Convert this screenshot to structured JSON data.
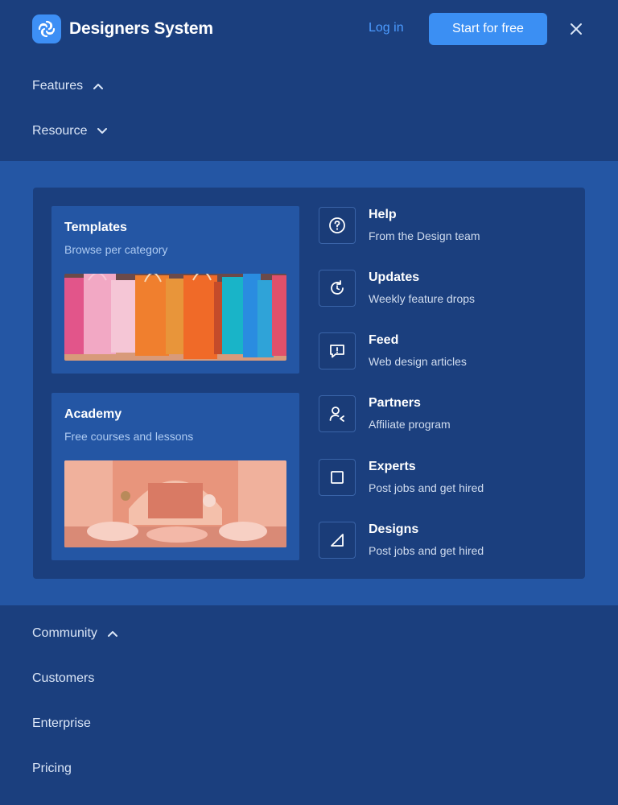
{
  "header": {
    "brand": "Designers System",
    "login_label": "Log in",
    "start_label": "Start for free"
  },
  "nav_top": [
    {
      "label": "Features",
      "expanded": true
    },
    {
      "label": "Resource",
      "expanded": false
    }
  ],
  "resources": {
    "tiles": [
      {
        "title": "Templates",
        "subtitle": "Browse per category"
      },
      {
        "title": "Academy",
        "subtitle": "Free courses and lessons"
      }
    ],
    "items": [
      {
        "title": "Help",
        "subtitle": "From the Design team",
        "icon": "help-circle-icon"
      },
      {
        "title": "Updates",
        "subtitle": "Weekly feature drops",
        "icon": "refresh-icon"
      },
      {
        "title": "Feed",
        "subtitle": "Web design articles",
        "icon": "message-alert-icon"
      },
      {
        "title": "Partners",
        "subtitle": "Affiliate program",
        "icon": "user-return-icon"
      },
      {
        "title": "Experts",
        "subtitle": "Post jobs and get hired",
        "icon": "square-icon"
      },
      {
        "title": "Designs",
        "subtitle": "Post jobs and get hired",
        "icon": "triangle-icon"
      }
    ]
  },
  "nav_bottom": [
    {
      "label": "Community",
      "expanded": true
    },
    {
      "label": "Customers"
    },
    {
      "label": "Enterprise"
    },
    {
      "label": "Pricing"
    }
  ],
  "colors": {
    "background": "#1b3f7e",
    "band": "#2456a4",
    "accent": "#3b8ff3",
    "link": "#4c9bff"
  }
}
